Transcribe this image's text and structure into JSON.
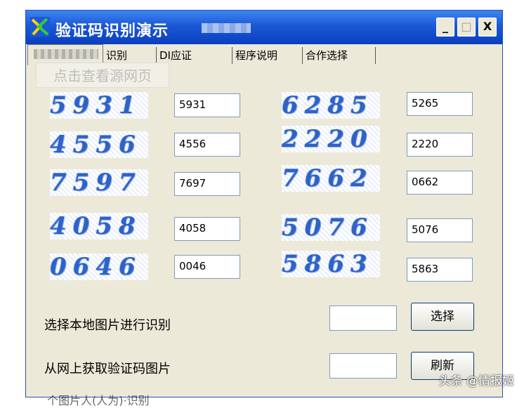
{
  "window": {
    "title": "验证码识别演示",
    "min_label": "_",
    "max_label": "□",
    "close_label": "X"
  },
  "tabs": [
    {
      "label": ""
    },
    {
      "label": "识别"
    },
    {
      "label": "DI应证"
    },
    {
      "label": "程序说明"
    },
    {
      "label": "合作选择"
    }
  ],
  "watermark": "点击查看源网页",
  "captchas": [
    {
      "image_text": "5931",
      "result": "5931"
    },
    {
      "image_text": "6285",
      "result": "5265"
    },
    {
      "image_text": "4556",
      "result": "4556"
    },
    {
      "image_text": "2220",
      "result": "2220"
    },
    {
      "image_text": "7597",
      "result": "7697"
    },
    {
      "image_text": "7662",
      "result": "0662"
    },
    {
      "image_text": "4058",
      "result": "4058"
    },
    {
      "image_text": "5076",
      "result": "5076"
    },
    {
      "image_text": "0646",
      "result": "0046"
    },
    {
      "image_text": "5863",
      "result": "5863"
    }
  ],
  "local": {
    "label": "选择本地图片进行识别",
    "button": "选择"
  },
  "web": {
    "label": "从网上获取验证码图片",
    "button": "刷新"
  },
  "bottom_text": "个图片人(人为)·识别",
  "source_watermark": "头条 @情报姬"
}
